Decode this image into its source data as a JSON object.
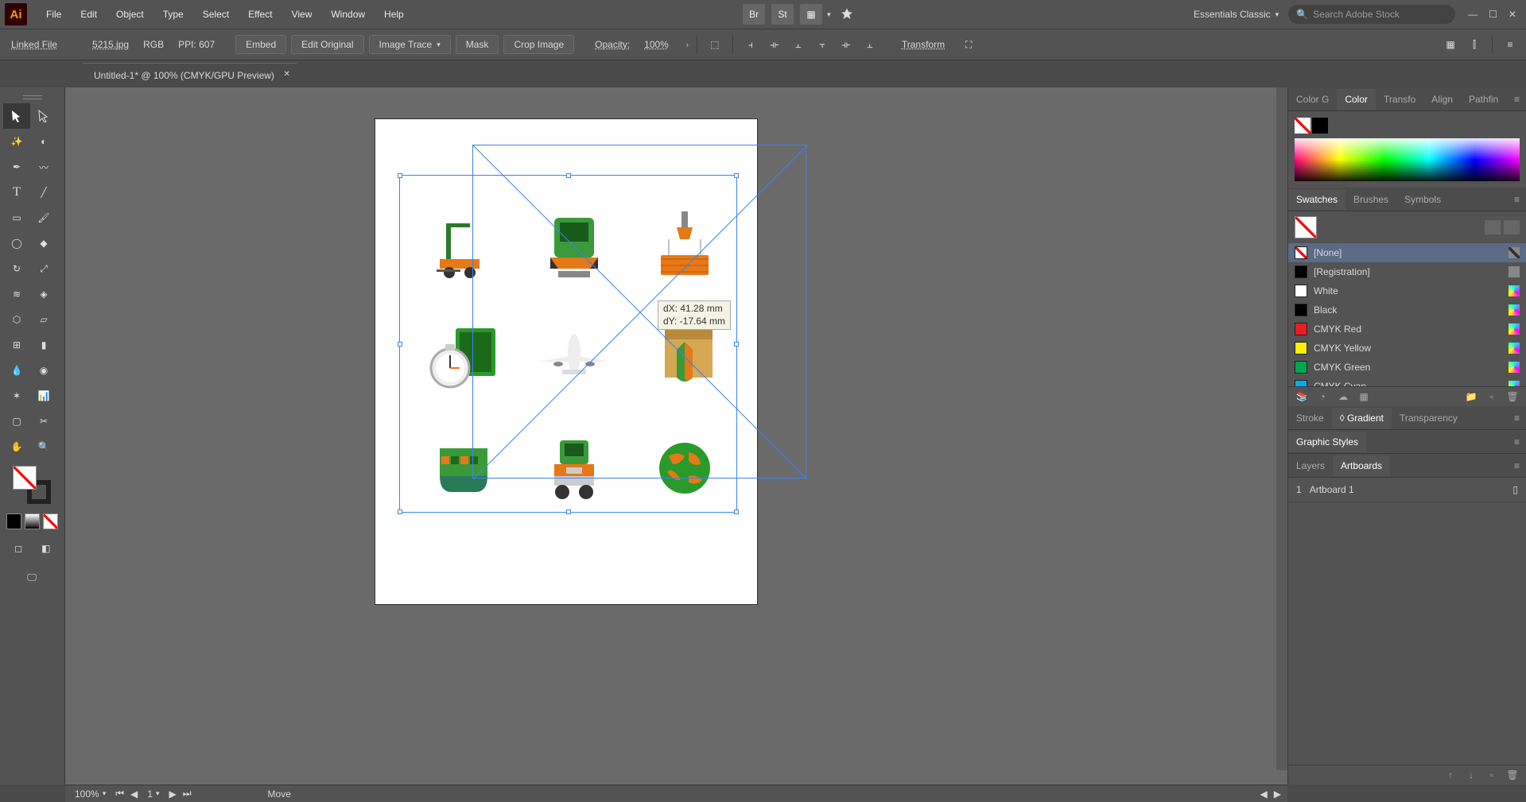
{
  "menubar": {
    "items": [
      "File",
      "Edit",
      "Object",
      "Type",
      "Select",
      "Effect",
      "View",
      "Window",
      "Help"
    ],
    "workspace": "Essentials Classic",
    "search_placeholder": "Search Adobe Stock"
  },
  "control": {
    "type_label": "Linked File",
    "filename": "5215.jpg",
    "color_mode": "RGB",
    "ppi_label": "PPI: 607",
    "embed": "Embed",
    "edit_original": "Edit Original",
    "image_trace": "Image Trace",
    "mask": "Mask",
    "crop_image": "Crop Image",
    "opacity_label": "Opacity:",
    "opacity_value": "100%",
    "transform": "Transform"
  },
  "document": {
    "tab_title": "Untitled-1* @ 100% (CMYK/GPU Preview)"
  },
  "hint": {
    "line1": "dX: 41.28 mm",
    "line2": "dY: -17.64 mm"
  },
  "status": {
    "zoom": "100%",
    "artboard_nav": "1",
    "action": "Move"
  },
  "panels": {
    "color": {
      "tabs": [
        "Color G",
        "Color",
        "Transfo",
        "Align",
        "Pathfin"
      ],
      "active": 1
    },
    "swatches": {
      "tabs": [
        "Swatches",
        "Brushes",
        "Symbols"
      ],
      "active": 0,
      "items": [
        {
          "name": "[None]",
          "color": "none",
          "sel": true
        },
        {
          "name": "[Registration]",
          "color": "#000"
        },
        {
          "name": "White",
          "color": "#fff"
        },
        {
          "name": "Black",
          "color": "#000"
        },
        {
          "name": "CMYK Red",
          "color": "#ed1c24"
        },
        {
          "name": "CMYK Yellow",
          "color": "#fff200"
        },
        {
          "name": "CMYK Green",
          "color": "#00a651"
        },
        {
          "name": "CMYK Cyan",
          "color": "#00aeef"
        }
      ]
    },
    "stroke": {
      "tabs": [
        "Stroke",
        "Gradient",
        "Transparency"
      ],
      "active": 1
    },
    "gstyles": {
      "tabs": [
        "Graphic Styles"
      ],
      "active": 0
    },
    "layers": {
      "tabs": [
        "Layers",
        "Artboards"
      ],
      "active": 1,
      "artboards": [
        {
          "num": "1",
          "name": "Artboard 1"
        }
      ]
    }
  }
}
